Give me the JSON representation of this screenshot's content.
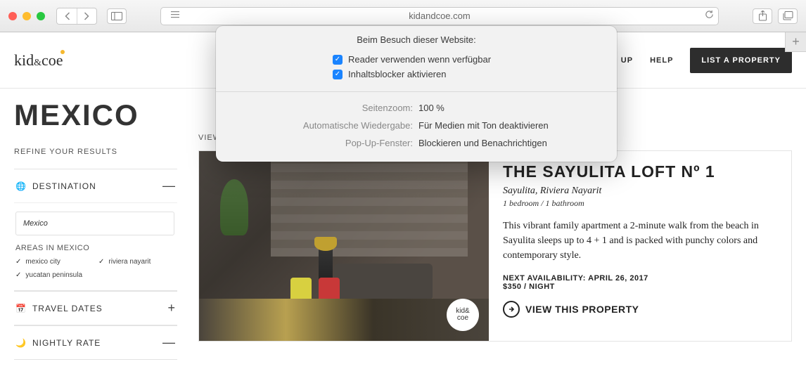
{
  "browser": {
    "url": "kidandcoe.com"
  },
  "popover": {
    "title": "Beim Besuch dieser Website:",
    "check1": "Reader verwenden wenn verfügbar",
    "check2": "Inhaltsblocker aktivieren",
    "zoom_label": "Seitenzoom:",
    "zoom_value": "100 %",
    "autoplay_label": "Automatische Wiedergabe:",
    "autoplay_value": "Für Medien mit Ton deaktivieren",
    "popup_label": "Pop-Up-Fenster:",
    "popup_value": "Blockieren und Benachrichtigen"
  },
  "header": {
    "logo1": "kid",
    "logo_amp": "&",
    "logo2": "coe",
    "signup": "SIGN UP",
    "help": "HELP",
    "cta": "LIST A PROPERTY"
  },
  "page": {
    "title": "MEXICO",
    "refine": "REFINE YOUR RESULTS",
    "view_as": "VIEW"
  },
  "filters": {
    "destination": {
      "label": "DESTINATION",
      "toggle": "—",
      "input": "Mexico",
      "areas_label": "AREAS IN MEXICO",
      "areas": [
        "mexico city",
        "riviera nayarit",
        "yucatan peninsula"
      ]
    },
    "travel_dates": {
      "label": "TRAVEL DATES",
      "toggle": "+"
    },
    "nightly_rate": {
      "label": "NIGHTLY RATE",
      "toggle": "—"
    }
  },
  "listing": {
    "title": "THE SAYULITA LOFT Nº 1",
    "location": "Sayulita, Riviera Nayarit",
    "rooms": "1 bedroom / 1 bathroom",
    "description": "This vibrant family apartment a 2-minute walk from the beach in Sayulita sleeps up to 4 + 1 and is packed with punchy colors and contemporary style.",
    "availability": "NEXT AVAILABILITY: APRIL 26, 2017",
    "price": "$350 / NIGHT",
    "link": "VIEW THIS PROPERTY",
    "badge": "kid&\ncoe"
  }
}
